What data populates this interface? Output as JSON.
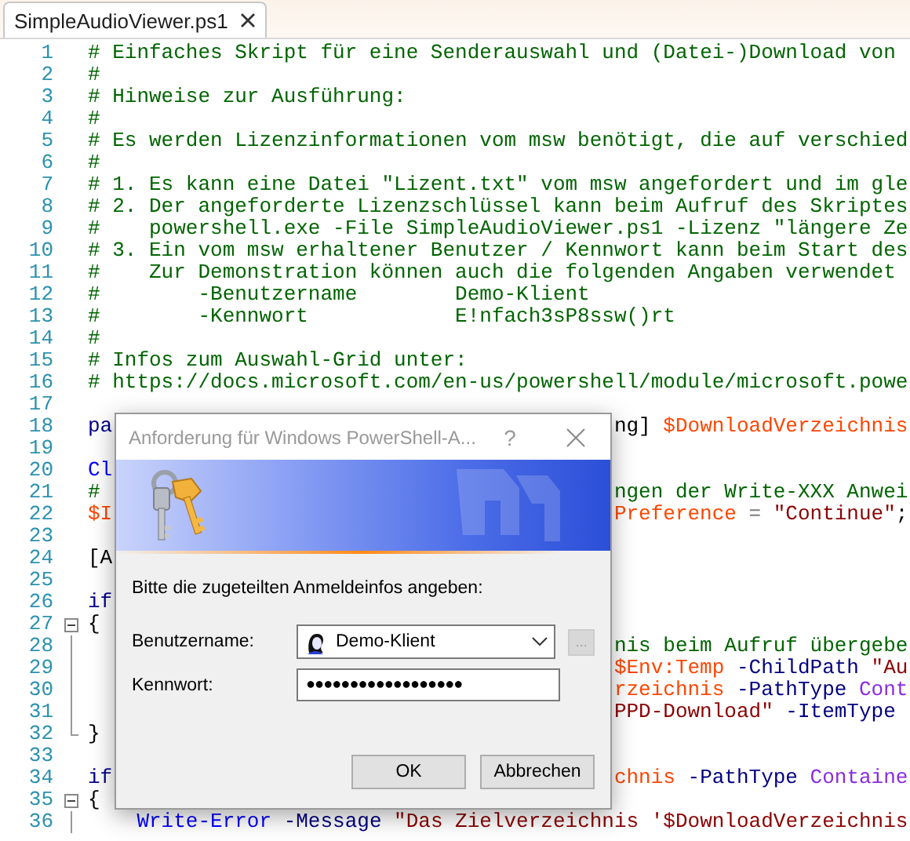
{
  "tabs": [
    {
      "label": "SimpleAudioViewer.ps1",
      "selected": true
    }
  ],
  "editor": {
    "lines": [
      {
        "number": "1",
        "segments": [
          {
            "text": "# Einfaches Skript für eine Senderauswahl und (Datei-)Download von",
            "kind": "comment"
          }
        ]
      },
      {
        "number": "2",
        "segments": [
          {
            "text": "#",
            "kind": "comment"
          }
        ]
      },
      {
        "number": "3",
        "segments": [
          {
            "text": "# Hinweise zur Ausführung:",
            "kind": "comment"
          }
        ]
      },
      {
        "number": "4",
        "segments": [
          {
            "text": "#",
            "kind": "comment"
          }
        ]
      },
      {
        "number": "5",
        "segments": [
          {
            "text": "# Es werden Lizenzinformationen vom msw benötigt, die auf verschied",
            "kind": "comment"
          }
        ]
      },
      {
        "number": "6",
        "segments": [
          {
            "text": "#",
            "kind": "comment"
          }
        ]
      },
      {
        "number": "7",
        "segments": [
          {
            "text": "# 1. Es kann eine Datei \"Lizent.txt\" vom msw angefordert und im gle",
            "kind": "comment"
          }
        ]
      },
      {
        "number": "8",
        "segments": [
          {
            "text": "# 2. Der angeforderte Lizenzschlüssel kann beim Aufruf des Skriptes",
            "kind": "comment"
          }
        ]
      },
      {
        "number": "9",
        "segments": [
          {
            "text": "#    powershell.exe -File SimpleAudioViewer.ps1 -Lizenz \"längere Ze",
            "kind": "comment"
          }
        ]
      },
      {
        "number": "10",
        "segments": [
          {
            "text": "# 3. Ein vom msw erhaltener Benutzer / Kennwort kann beim Start des",
            "kind": "comment"
          }
        ]
      },
      {
        "number": "11",
        "segments": [
          {
            "text": "#    Zur Demonstration können auch die folgenden Angaben verwendet",
            "kind": "comment"
          }
        ]
      },
      {
        "number": "12",
        "segments": [
          {
            "text": "#        -Benutzername        Demo-Klient",
            "kind": "comment"
          }
        ]
      },
      {
        "number": "13",
        "segments": [
          {
            "text": "#        -Kennwort            E!nfach3sP8ssw()rt",
            "kind": "comment"
          }
        ]
      },
      {
        "number": "14",
        "segments": [
          {
            "text": "#",
            "kind": "comment"
          }
        ]
      },
      {
        "number": "15",
        "segments": [
          {
            "text": "# Infos zum Auswahl-Grid unter:",
            "kind": "comment"
          }
        ]
      },
      {
        "number": "16",
        "segments": [
          {
            "text": "# https://docs.microsoft.com/en-us/powershell/module/microsoft.powe",
            "kind": "comment"
          }
        ]
      },
      {
        "number": "17"
      },
      {
        "number": "18",
        "segments": [
          {
            "text": "pa",
            "kind": "keyword"
          }
        ],
        "right_segments": [
          {
            "text": "ng] ",
            "kind": "plain"
          },
          {
            "text": "$DownloadVerzeichnis",
            "kind": "variable"
          }
        ]
      },
      {
        "number": "19"
      },
      {
        "number": "20",
        "segments": [
          {
            "text": "Cl",
            "kind": "cmdlet"
          }
        ]
      },
      {
        "number": "21",
        "segments": [
          {
            "text": "#",
            "kind": "comment"
          }
        ],
        "right_segments": [
          {
            "text": "ngen der Write-XXX Anwei",
            "kind": "comment"
          }
        ]
      },
      {
        "number": "22",
        "segments": [
          {
            "text": "$I",
            "kind": "variable"
          }
        ],
        "right_segments": [
          {
            "text": "Preference",
            "kind": "variable"
          },
          {
            "text": " = ",
            "kind": "operator"
          },
          {
            "text": "\"Continue\"",
            "kind": "string"
          },
          {
            "text": ";",
            "kind": "plain"
          }
        ]
      },
      {
        "number": "23"
      },
      {
        "number": "24",
        "segments": [
          {
            "text": "[A",
            "kind": "plain"
          }
        ]
      },
      {
        "number": "25"
      },
      {
        "number": "26",
        "segments": [
          {
            "text": "if",
            "kind": "keyword"
          }
        ]
      },
      {
        "number": "27",
        "kind": "fold_start",
        "segments": [
          {
            "text": "{",
            "kind": "plain"
          }
        ]
      },
      {
        "number": "28",
        "kind": "fold_body",
        "right_segments": [
          {
            "text": "nis beim Aufruf übergebe",
            "kind": "comment"
          }
        ]
      },
      {
        "number": "29",
        "kind": "fold_body",
        "right_segments": [
          {
            "text": "$Env:Temp",
            "kind": "variable"
          },
          {
            "text": " -ChildPath ",
            "kind": "param"
          },
          {
            "text": "\"Au",
            "kind": "string"
          }
        ]
      },
      {
        "number": "30",
        "kind": "fold_body",
        "right_segments": [
          {
            "text": "rzeichnis",
            "kind": "variable"
          },
          {
            "text": " -PathType ",
            "kind": "param"
          },
          {
            "text": "Cont",
            "kind": "type"
          }
        ]
      },
      {
        "number": "31",
        "kind": "fold_body",
        "right_segments": [
          {
            "text": "PPD-Download\"",
            "kind": "string"
          },
          {
            "text": " -ItemType ",
            "kind": "param"
          }
        ]
      },
      {
        "number": "32",
        "kind": "fold_end",
        "segments": [
          {
            "text": "}",
            "kind": "plain"
          }
        ]
      },
      {
        "number": "33"
      },
      {
        "number": "34",
        "segments": [
          {
            "text": "if",
            "kind": "keyword"
          }
        ],
        "right_segments": [
          {
            "text": "chnis",
            "kind": "variable"
          },
          {
            "text": " -PathType ",
            "kind": "param"
          },
          {
            "text": "Containe",
            "kind": "type"
          }
        ]
      },
      {
        "number": "35",
        "kind": "fold_start",
        "segments": [
          {
            "text": "{",
            "kind": "plain"
          }
        ]
      },
      {
        "number": "36",
        "kind": "fold_body",
        "segments": [
          {
            "text": "    Write-Error",
            "kind": "cmdlet"
          },
          {
            "text": " -Message ",
            "kind": "param"
          },
          {
            "text": "\"Das Zielverzeichnis '$DownloadVerzeichnis",
            "kind": "string"
          }
        ]
      }
    ]
  },
  "dialog": {
    "title": "Anforderung für Windows PowerShell-A...",
    "help": "?",
    "prompt": "Bitte die zugeteilten Anmeldeinfos angeben:",
    "username_label": "Benutzername:",
    "username_value": "Demo-Klient",
    "browse_button": {
      "label": "...",
      "disabled": true
    },
    "password_label": "Kennwort:",
    "password_value": "●●●●●●●●●●●●●●●●●●",
    "buttons": [
      "OK",
      "Abbrechen"
    ]
  }
}
